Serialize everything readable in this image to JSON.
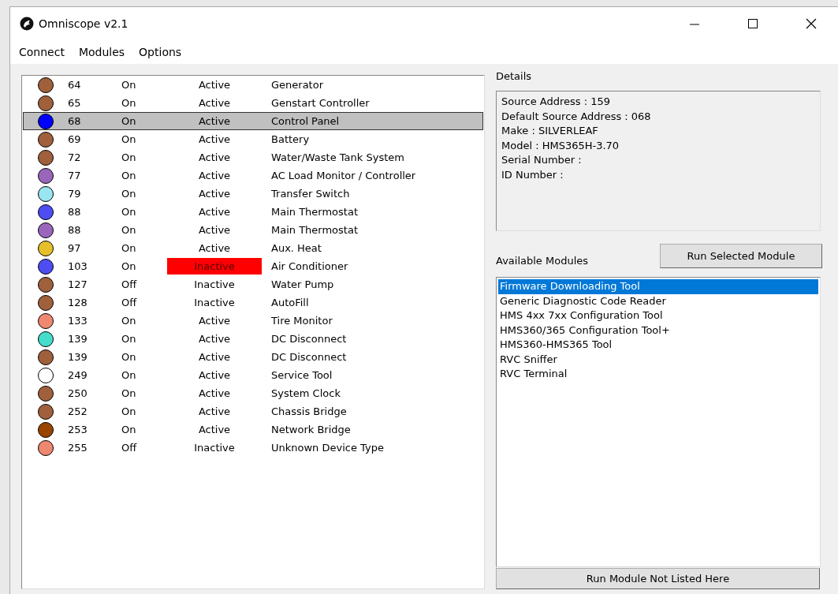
{
  "window": {
    "title": "Omniscope v2.1"
  },
  "menu": [
    "Connect",
    "Modules",
    "Options"
  ],
  "devices": [
    {
      "color": "#a0603c",
      "address": "64",
      "power": "On",
      "status": "Active",
      "alert": false,
      "name": "Generator",
      "selected": false
    },
    {
      "color": "#a0603c",
      "address": "65",
      "power": "On",
      "status": "Active",
      "alert": false,
      "name": "Genstart Controller",
      "selected": false
    },
    {
      "color": "#0000ff",
      "address": "68",
      "power": "On",
      "status": "Active",
      "alert": false,
      "name": "Control Panel",
      "selected": true
    },
    {
      "color": "#a0603c",
      "address": "69",
      "power": "On",
      "status": "Active",
      "alert": false,
      "name": "Battery",
      "selected": false
    },
    {
      "color": "#a0603c",
      "address": "72",
      "power": "On",
      "status": "Active",
      "alert": false,
      "name": "Water/Waste Tank System",
      "selected": false
    },
    {
      "color": "#9966bb",
      "address": "77",
      "power": "On",
      "status": "Active",
      "alert": false,
      "name": "AC Load Monitor / Controller",
      "selected": false
    },
    {
      "color": "#99e6f2",
      "address": "79",
      "power": "On",
      "status": "Active",
      "alert": false,
      "name": "Transfer Switch",
      "selected": false
    },
    {
      "color": "#4d4df2",
      "address": "88",
      "power": "On",
      "status": "Active",
      "alert": false,
      "name": "Main Thermostat",
      "selected": false
    },
    {
      "color": "#9966bb",
      "address": "88",
      "power": "On",
      "status": "Active",
      "alert": false,
      "name": "Main Thermostat",
      "selected": false
    },
    {
      "color": "#e6c02a",
      "address": "97",
      "power": "On",
      "status": "Active",
      "alert": false,
      "name": "Aux. Heat",
      "selected": false
    },
    {
      "color": "#4d4df2",
      "address": "103",
      "power": "On",
      "status": "Inactive",
      "alert": true,
      "name": "Air Conditioner",
      "selected": false
    },
    {
      "color": "#a0603c",
      "address": "127",
      "power": "Off",
      "status": "Inactive",
      "alert": false,
      "name": "Water Pump",
      "selected": false
    },
    {
      "color": "#a0603c",
      "address": "128",
      "power": "Off",
      "status": "Inactive",
      "alert": false,
      "name": "AutoFill",
      "selected": false
    },
    {
      "color": "#ee8870",
      "address": "133",
      "power": "On",
      "status": "Active",
      "alert": false,
      "name": "Tire Monitor",
      "selected": false
    },
    {
      "color": "#44ddcc",
      "address": "139",
      "power": "On",
      "status": "Active",
      "alert": false,
      "name": "DC Disconnect",
      "selected": false
    },
    {
      "color": "#a0603c",
      "address": "139",
      "power": "On",
      "status": "Active",
      "alert": false,
      "name": "DC Disconnect",
      "selected": false
    },
    {
      "color": "#ffffff",
      "address": "249",
      "power": "On",
      "status": "Active",
      "alert": false,
      "name": "Service Tool",
      "selected": false
    },
    {
      "color": "#a0603c",
      "address": "250",
      "power": "On",
      "status": "Active",
      "alert": false,
      "name": "System Clock",
      "selected": false
    },
    {
      "color": "#a0603c",
      "address": "252",
      "power": "On",
      "status": "Active",
      "alert": false,
      "name": "Chassis Bridge",
      "selected": false
    },
    {
      "color": "#994400",
      "address": "253",
      "power": "On",
      "status": "Active",
      "alert": false,
      "name": "Network Bridge",
      "selected": false
    },
    {
      "color": "#ee8870",
      "address": "255",
      "power": "Off",
      "status": "Inactive",
      "alert": false,
      "name": "Unknown Device Type",
      "selected": false
    }
  ],
  "details": {
    "label": "Details",
    "lines": [
      "Source Address : 159",
      "Default Source Address : 068",
      "Make : SILVERLEAF",
      "Model : HMS365H-3.70",
      "Serial Number :",
      "ID Number :"
    ]
  },
  "modules": {
    "label": "Available Modules",
    "run_button": "Run Selected Module",
    "items": [
      {
        "label": "Firmware Downloading Tool",
        "selected": true
      },
      {
        "label": "Generic Diagnostic Code Reader",
        "selected": false
      },
      {
        "label": "HMS 4xx 7xx Configuration Tool",
        "selected": false
      },
      {
        "label": "HMS360/365 Configuration Tool+",
        "selected": false
      },
      {
        "label": "HMS360-HMS365 Tool",
        "selected": false
      },
      {
        "label": "RVC Sniffer",
        "selected": false
      },
      {
        "label": "RVC Terminal",
        "selected": false
      }
    ],
    "other_button": "Run Module Not Listed Here"
  }
}
